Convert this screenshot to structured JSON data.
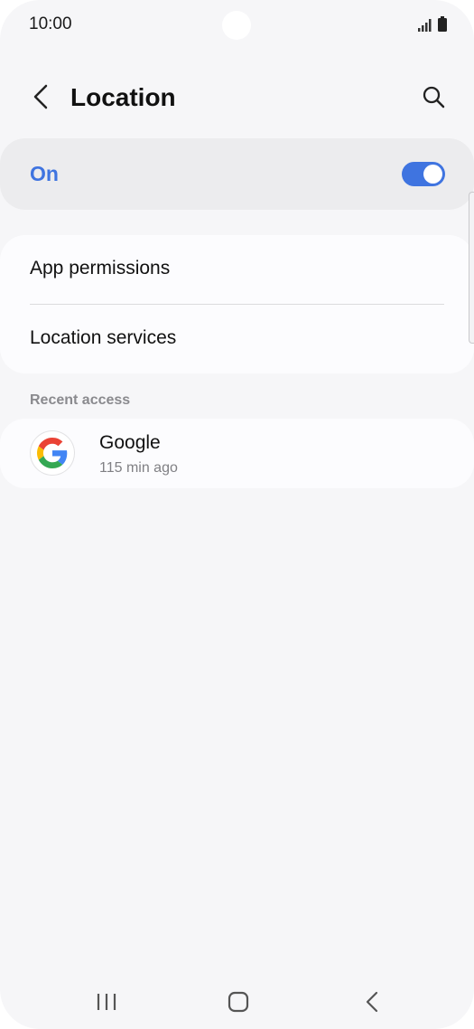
{
  "status_bar": {
    "time": "10:00"
  },
  "header": {
    "title": "Location"
  },
  "master_toggle": {
    "label": "On",
    "state": true,
    "accent_color": "#3f74e0"
  },
  "menu": {
    "items": [
      {
        "label": "App permissions"
      },
      {
        "label": "Location services"
      }
    ]
  },
  "recent_access": {
    "header": "Recent access",
    "items": [
      {
        "app": "Google",
        "time": "115 min ago",
        "icon": "google-g-icon"
      }
    ]
  },
  "icons": {
    "back": "chevron-left-icon",
    "search": "search-icon",
    "signal": "signal-icon",
    "battery": "battery-icon",
    "nav_recents": "recents-icon",
    "nav_home": "home-icon",
    "nav_back": "back-icon"
  }
}
